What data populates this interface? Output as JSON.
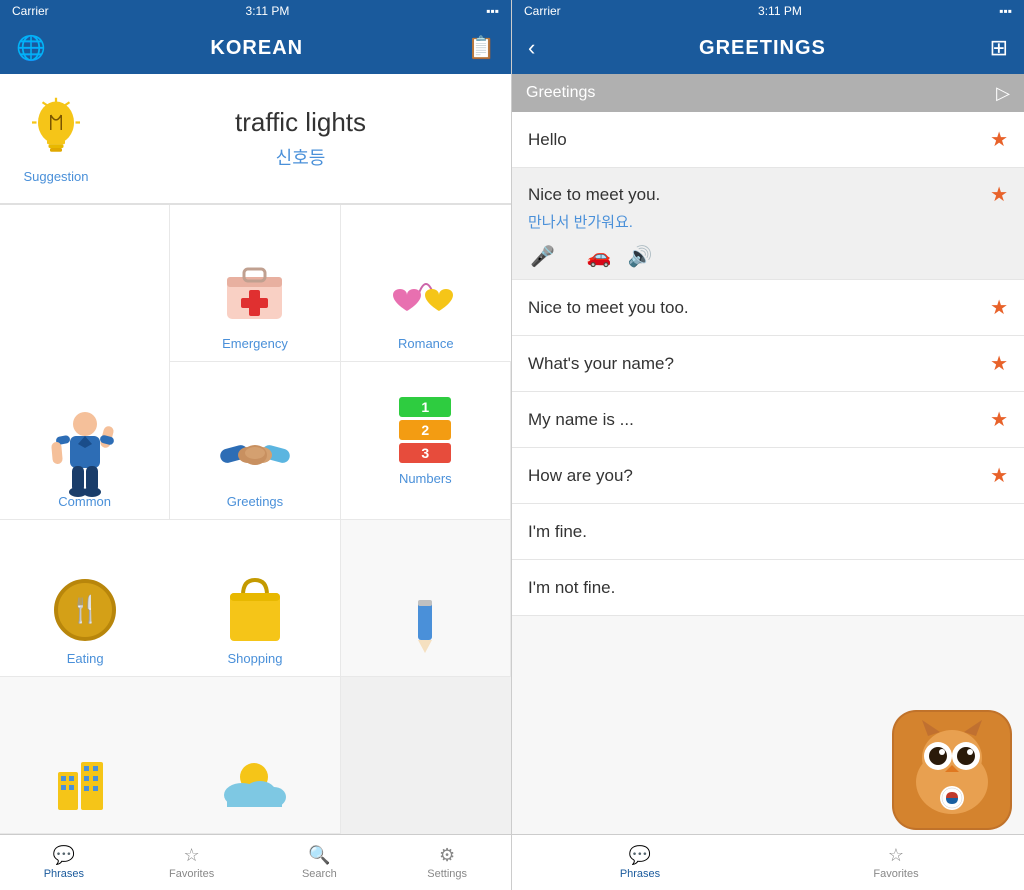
{
  "left_phone": {
    "status_bar": {
      "carrier": "Carrier",
      "wifi": "WiFi",
      "time": "3:11 PM",
      "battery": "Battery"
    },
    "header": {
      "title": "KOREAN",
      "globe_icon": "globe-icon",
      "book_icon": "book-icon"
    },
    "suggestion": {
      "label": "Suggestion",
      "english": "traffic lights",
      "korean": "신호등"
    },
    "categories": [
      {
        "id": "common",
        "label": "Common",
        "icon": "person"
      },
      {
        "id": "emergency",
        "label": "Emergency",
        "icon": "emergency"
      },
      {
        "id": "romance",
        "label": "Romance",
        "icon": "romance"
      },
      {
        "id": "greetings",
        "label": "Greetings",
        "icon": "handshake"
      },
      {
        "id": "numbers",
        "label": "Numbers",
        "icon": "numbers"
      },
      {
        "id": "eating",
        "label": "Eating",
        "icon": "eating"
      },
      {
        "id": "shopping",
        "label": "Shopping",
        "icon": "shopping"
      },
      {
        "id": "col3row3",
        "label": "",
        "icon": "numbers2"
      },
      {
        "id": "pencil",
        "label": "",
        "icon": "pencil"
      },
      {
        "id": "city",
        "label": "",
        "icon": "city"
      },
      {
        "id": "weather",
        "label": "",
        "icon": "weather"
      }
    ],
    "tabs": [
      {
        "id": "phrases",
        "label": "Phrases",
        "active": true
      },
      {
        "id": "favorites",
        "label": "Favorites",
        "active": false
      },
      {
        "id": "search",
        "label": "Search",
        "active": false
      },
      {
        "id": "settings",
        "label": "Settings",
        "active": false
      }
    ]
  },
  "right_phone": {
    "status_bar": {
      "carrier": "Carrier",
      "time": "3:11 PM",
      "battery": "Battery"
    },
    "header": {
      "title": "GREETINGS",
      "back_label": "‹",
      "layers_icon": "layers-icon"
    },
    "section_header": {
      "label": "Greetings",
      "play_icon": "play-icon"
    },
    "phrases": [
      {
        "id": "hello",
        "text": "Hello",
        "expanded": false,
        "starred": true
      },
      {
        "id": "nice-to-meet",
        "text": "Nice to meet you.",
        "korean": "만나서 반가워요.",
        "expanded": true,
        "starred": true
      },
      {
        "id": "nice-too",
        "text": "Nice to meet you too.",
        "expanded": false,
        "starred": true
      },
      {
        "id": "whats-name",
        "text": "What's your name?",
        "expanded": false,
        "starred": true
      },
      {
        "id": "my-name",
        "text": "My name is ...",
        "expanded": false,
        "starred": true
      },
      {
        "id": "how-are-you",
        "text": "How are you?",
        "expanded": false,
        "starred": true
      },
      {
        "id": "im-fine",
        "text": "I'm fine.",
        "expanded": false,
        "starred": false
      },
      {
        "id": "im-not-fine",
        "text": "I'm not fine.",
        "expanded": false,
        "starred": false
      }
    ],
    "tabs": [
      {
        "id": "phrases",
        "label": "Phrases",
        "active": true
      },
      {
        "id": "favorites",
        "label": "Favorites",
        "active": false
      }
    ]
  }
}
